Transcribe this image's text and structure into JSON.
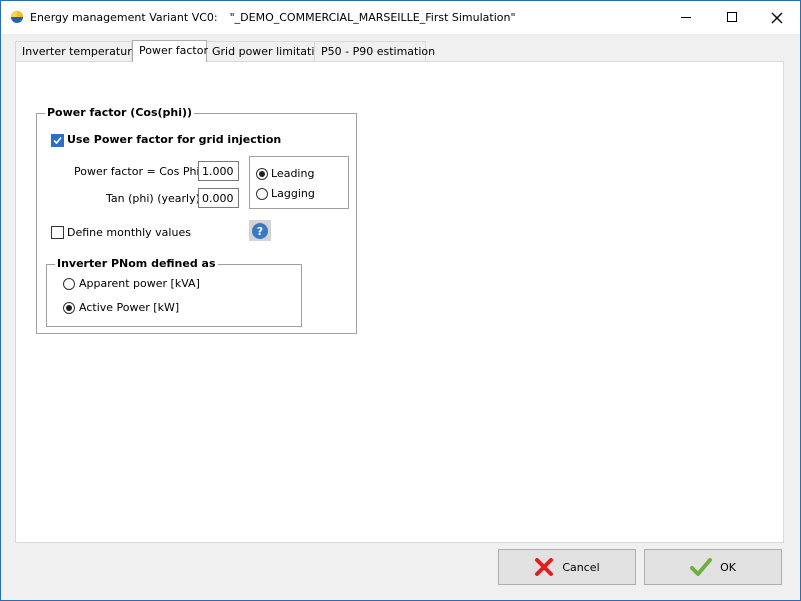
{
  "window": {
    "title_prefix": "Energy management Variant VC0:",
    "title_project": "\"_DEMO_COMMERCIAL_MARSEILLE_First Simulation\"",
    "controls": [
      "minimize",
      "maximize",
      "close"
    ]
  },
  "tabs": [
    {
      "label": "Inverter temperature",
      "active": false
    },
    {
      "label": "Power factor",
      "active": true
    },
    {
      "label": "Grid power limitation",
      "active": false
    },
    {
      "label": "P50 - P90 estimation",
      "active": false
    }
  ],
  "power_factor": {
    "group_title": "Power factor (Cos(phi))",
    "use_checkbox": {
      "label": "Use Power factor for grid injection",
      "checked": true
    },
    "cos_phi": {
      "label": "Power factor = Cos Phi",
      "value": "1.000"
    },
    "tan_phi": {
      "label": "Tan (phi) (yearly)",
      "value": "0.000"
    },
    "phase": {
      "options": [
        {
          "label": "Leading",
          "selected": true
        },
        {
          "label": "Lagging",
          "selected": false
        }
      ]
    },
    "monthly_checkbox": {
      "label": "Define monthly values",
      "checked": false
    }
  },
  "inverter_pnom": {
    "group_title": "Inverter PNom defined as",
    "options": [
      {
        "label": "Apparent power  [kVA]",
        "selected": false
      },
      {
        "label": "Active Power  [kW]",
        "selected": true
      }
    ]
  },
  "footer": {
    "cancel_label": "Cancel",
    "ok_label": "OK"
  },
  "colors": {
    "accent": "#2d6fc4",
    "cancel_icon": "#e02020",
    "ok_icon": "#6fb03c",
    "help_icon": "#3a78c2"
  }
}
